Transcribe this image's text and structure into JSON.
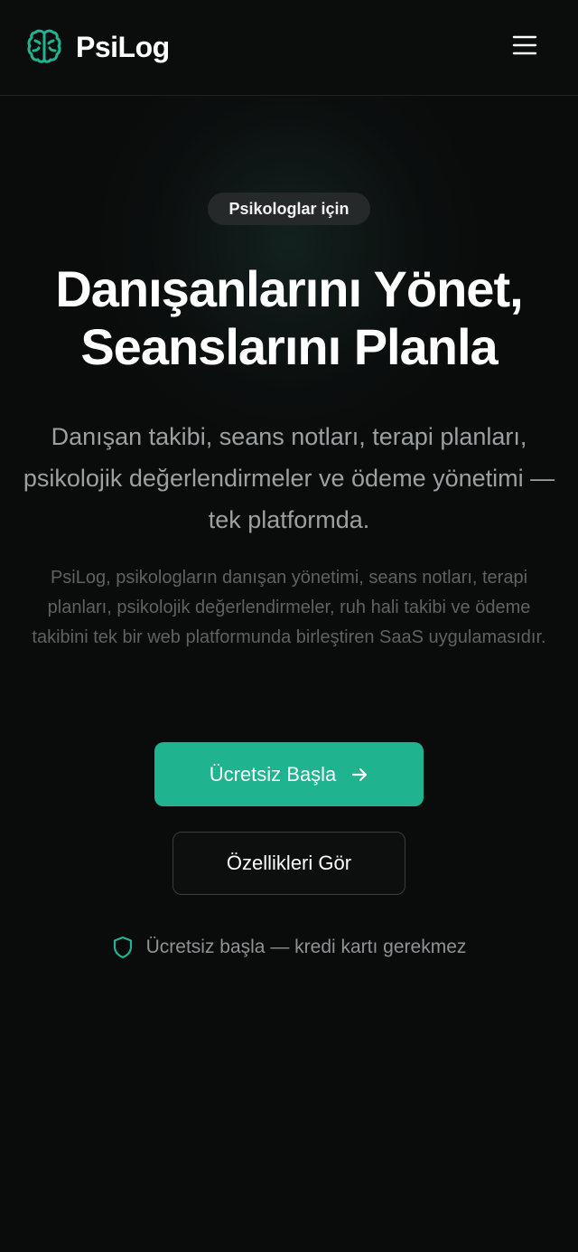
{
  "header": {
    "brand_name": "PsiLog",
    "logo_icon": "brain-icon",
    "menu_icon": "hamburger-menu-icon"
  },
  "hero": {
    "badge": "Psikologlar için",
    "title_line1": "Danışanlarını Yönet,",
    "title_line2": "Seanslarını Planla",
    "subtitle": "Danışan takibi, seans notları, terapi planları, psikolojik değerlendirmeler ve ödeme yönetimi — tek platformda.",
    "description": "PsiLog, psikologların danışan yönetimi, seans notları, terapi planları, psikolojik değerlendirmeler, ruh hali takibi ve ödeme takibini tek bir web platformunda birleştiren SaaS uygulamasıdır."
  },
  "actions": {
    "primary_label": "Ücretsiz Başla",
    "primary_icon": "arrow-right-icon",
    "secondary_label": "Özellikleri Gör"
  },
  "note": {
    "icon": "shield-icon",
    "text": "Ücretsiz başla — kredi kartı gerekmez"
  },
  "colors": {
    "background": "#0a0b0b",
    "accent": "#1fb38f",
    "badge_bg": "#262929",
    "subtitle_text": "#9ba0a0",
    "description_text": "#5d6262"
  }
}
